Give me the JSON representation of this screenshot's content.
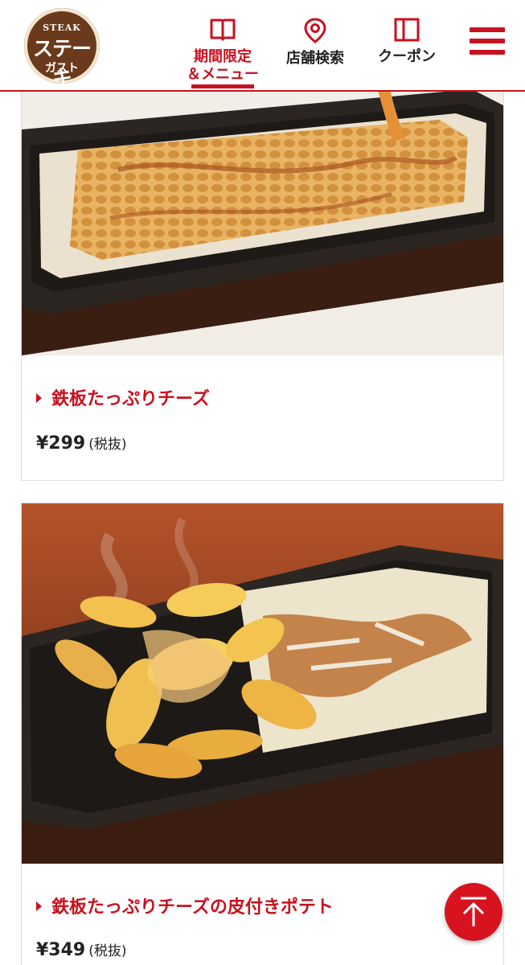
{
  "header": {
    "logo": {
      "top": "STEAK",
      "main": "ステーキ",
      "bottom": "ガスト"
    },
    "nav": [
      {
        "label_line1": "期間限定",
        "label_line2": "＆メニュー",
        "icon": "book-icon",
        "active": true
      },
      {
        "label": "店舗検索",
        "icon": "map-pin-icon"
      },
      {
        "label": "クーポン",
        "icon": "coupon-icon"
      }
    ],
    "menu_icon": "hamburger-menu-icon"
  },
  "products": [
    {
      "name": "鉄板たっぷりチーズ",
      "price": "¥299",
      "tax_note": "(税抜)",
      "image": "melted cheese on cast iron skillet"
    },
    {
      "name": "鉄板たっぷりチーズの皮付きポテト",
      "price": "¥349",
      "tax_note": "(税抜)",
      "image": "skin-on potato wedges with cheese on cast iron skillet"
    }
  ],
  "back_to_top": {
    "icon": "arrow-up-icon"
  },
  "colors": {
    "brand_red": "#c8111f",
    "logo_brown": "#6b3a1c",
    "text": "#222222",
    "card_border": "#dcdcdc"
  }
}
